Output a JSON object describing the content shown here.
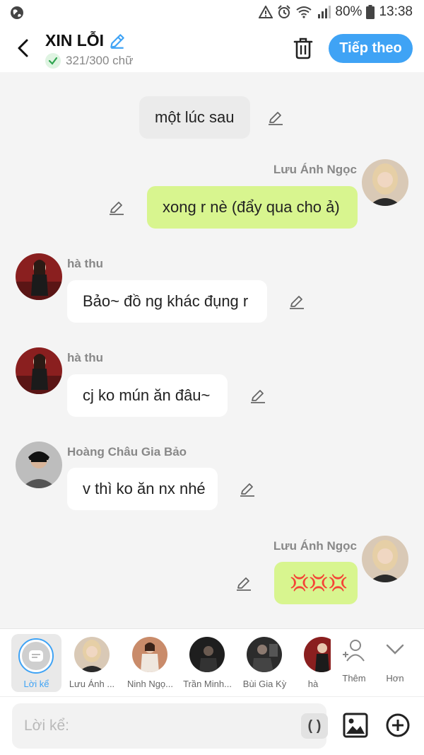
{
  "status": {
    "battery": "80%",
    "time": "13:38"
  },
  "header": {
    "title": "XIN LỖI",
    "word_count": "321/300 chữ",
    "next_label": "Tiếp theo"
  },
  "colors": {
    "accent": "#3fa3f5",
    "green_bubble": "#d8f58f"
  },
  "messages": [
    {
      "type": "narration",
      "text": "một lúc sau"
    },
    {
      "type": "right",
      "sender": "Lưu Ánh Ngọc",
      "text": "xong r nè (đẩy qua cho ả)"
    },
    {
      "type": "left",
      "sender": "hà thu",
      "text": "Bảo~ đồ ng khác đụng r"
    },
    {
      "type": "left",
      "sender": "hà thu",
      "text": "cj ko mún ăn đâu~"
    },
    {
      "type": "left",
      "sender": "Hoàng Châu Gia Bảo",
      "text": "v thì ko ăn nx nhé"
    },
    {
      "type": "right",
      "sender": "Lưu Ánh Ngọc",
      "text": "💢💢💢"
    }
  ],
  "characters": {
    "narrator": "Lời kể",
    "items": [
      "Lưu Ánh ...",
      "Ninh Ngọ...",
      "Trần Minh...",
      "Bùi Gia Kỳ",
      "hà"
    ],
    "more": "Thêm",
    "expand": "Hơn"
  },
  "input": {
    "placeholder": "Lời kể:",
    "paren_label": "( )"
  },
  "icons": [
    "globe-icon",
    "back-icon",
    "edit-title-icon",
    "check-icon",
    "trash-icon",
    "edit-icon",
    "add-character-icon",
    "chevron-down-icon",
    "image-icon",
    "plus-circle-icon"
  ]
}
